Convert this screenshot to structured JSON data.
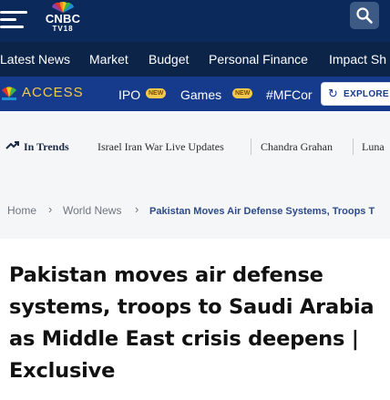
{
  "header": {
    "logo": {
      "brand": "CNBC",
      "sub": "TV18"
    },
    "icons": {
      "menu": "hamburger-icon",
      "search": "search-icon"
    }
  },
  "nav": {
    "items": [
      "Latest News",
      "Market",
      "Budget",
      "Personal Finance",
      "Impact Sh"
    ]
  },
  "access": {
    "label": "ACCESS",
    "items": [
      {
        "label": "IPO",
        "badge": "NEW"
      },
      {
        "label": "Games",
        "badge": "NEW"
      },
      {
        "label": "#MFCor"
      }
    ],
    "explore": "EXPLORE"
  },
  "trends": {
    "label": "In Trends",
    "items": [
      "Israel Iran War Live Updates",
      "Chandra Grahan",
      "Luna"
    ]
  },
  "breadcrumb": {
    "items": [
      "Home",
      "World News",
      "Pakistan Moves Air Defense Systems, Troops T"
    ]
  },
  "article": {
    "headline": "Pakistan moves air defense systems, troops to Saudi Arabia as Middle East crisis deepens | Exclusive"
  },
  "colors": {
    "header_bg": "#0b2a5b",
    "nav_bg": "#0d2449",
    "access_bg": "#163b8c",
    "access_accent": "#f2c94c",
    "page_bg": "#f5f6f8"
  }
}
